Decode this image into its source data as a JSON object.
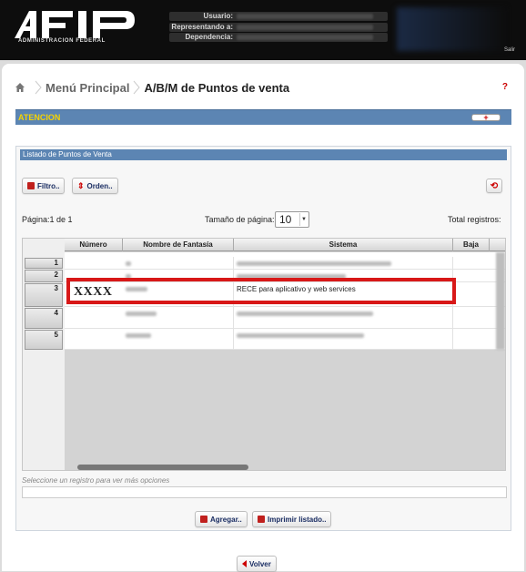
{
  "header": {
    "logo_alt": "AFIP",
    "logo_subtitle": "ADMINISTRACION FEDERAL",
    "user_label": "Usuario:",
    "represented_label": "Representando a:",
    "dependency_label": "Dependencia:",
    "logout_label": "Salir"
  },
  "breadcrumb": {
    "home_icon": "home-icon",
    "parent": "Menú Principal",
    "current": "A/B/M de Puntos de venta",
    "help": "?"
  },
  "attention": {
    "title": "ATENCION",
    "toggle": "+"
  },
  "list": {
    "title": "Listado de Puntos de Venta",
    "filter_button": "Filtro..",
    "order_button": "Orden..",
    "refresh_icon": "refresh-icon",
    "page_info": "Página:1 de 1",
    "page_size_label": "Tamaño de página:",
    "page_size_value": "10",
    "total_label": "Total registros:",
    "columns": [
      "Número",
      "Nombre de Fantasía",
      "Sistema",
      "Baja"
    ],
    "rows": [
      {
        "index": "1",
        "sistema": ""
      },
      {
        "index": "2",
        "sistema": ""
      },
      {
        "index": "3",
        "numero": "XXXX",
        "sistema": "RECE para aplicativo y web services"
      },
      {
        "index": "4",
        "sistema": ""
      },
      {
        "index": "5",
        "sistema": ""
      }
    ],
    "selection_hint": "Seleccione un registro para ver más opciones",
    "add_button": "Agregar..",
    "print_button": "Imprimir listado..",
    "back_button": "Volver"
  },
  "colors": {
    "bar_blue": "#5c85b3",
    "attention_yellow": "#f5d300",
    "highlight_red": "#d81818",
    "button_text": "#1a2d63"
  }
}
